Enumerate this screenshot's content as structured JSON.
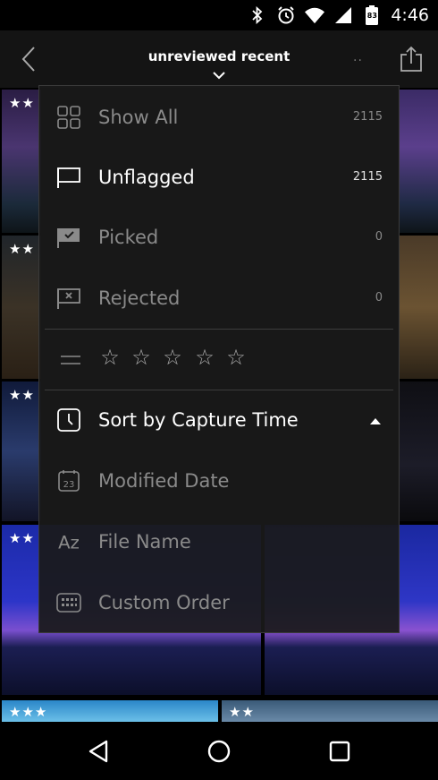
{
  "status_bar": {
    "time": "4:46",
    "battery": "83"
  },
  "app_bar": {
    "title": "unreviewed recent",
    "more": "··"
  },
  "thumb_stars": [
    "★★",
    "★★",
    "★★",
    "★★",
    "★★★",
    "★★"
  ],
  "filter_menu": {
    "items": [
      {
        "label": "Show All",
        "count": "2115"
      },
      {
        "label": "Unflagged",
        "count": "2115"
      },
      {
        "label": "Picked",
        "count": "0"
      },
      {
        "label": "Rejected",
        "count": "0"
      }
    ],
    "rating_stars": [
      "☆",
      "☆",
      "☆",
      "☆",
      "☆"
    ]
  },
  "sort_menu": {
    "items": [
      {
        "label": "Sort by Capture Time"
      },
      {
        "label": "Modified Date"
      },
      {
        "label": "File Name"
      },
      {
        "label": "Custom Order"
      }
    ]
  },
  "icons": {
    "status": [
      "bluetooth-icon",
      "alarm-icon",
      "wifi-icon",
      "cell-signal-icon",
      "battery-icon"
    ],
    "nav": [
      "back-triangle-icon",
      "home-circle-icon",
      "recents-square-icon"
    ]
  },
  "colors": {
    "active_text": "#ffffff",
    "inactive_text": "#8a8a8a",
    "panel_bg": "#1a1a1a"
  }
}
